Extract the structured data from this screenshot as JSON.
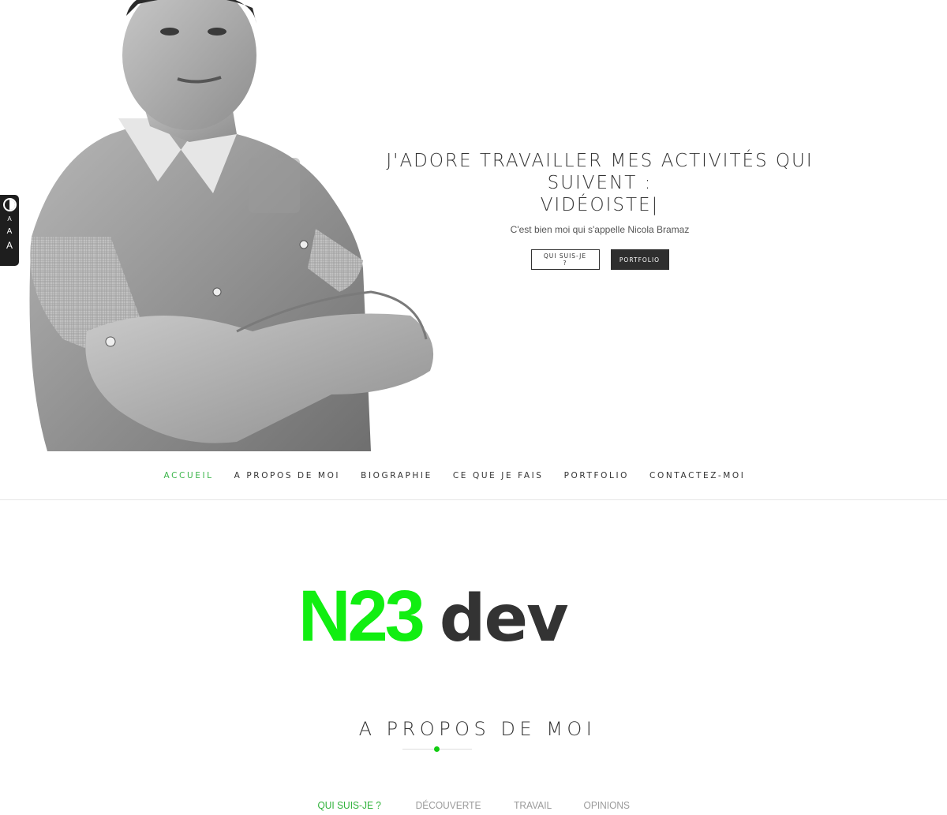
{
  "hero": {
    "title_line1": "J'ADORE TRAVAILLER MES ACTIVITÉS QUI SUIVENT :",
    "title_line2": "VIDÉOISTE",
    "title_cursor": "|",
    "subtitle": "C'est bien moi qui s'appelle Nicola Bramaz",
    "buttons": {
      "about": "QUI SUIS-JE ?",
      "portfolio": "PORTFOLIO"
    }
  },
  "accessibility": {
    "icon": "contrast-icon",
    "font_small": "A",
    "font_medium": "A",
    "font_large": "A"
  },
  "nav": {
    "items": [
      {
        "label": "ACCUEIL",
        "active": true
      },
      {
        "label": "A PROPOS DE MOI",
        "active": false
      },
      {
        "label": "BIOGRAPHIE",
        "active": false
      },
      {
        "label": "CE QUE JE FAIS",
        "active": false
      },
      {
        "label": "PORTFOLIO",
        "active": false
      },
      {
        "label": "CONTACTEZ-MOI",
        "active": false
      }
    ]
  },
  "logo": {
    "part1": "N23",
    "part2": "dev"
  },
  "section": {
    "title": "A PROPOS DE MOI",
    "tabs": [
      {
        "label": "QUI SUIS-JE ?",
        "active": true
      },
      {
        "label": "DÉCOUVERTE",
        "active": false
      },
      {
        "label": "TRAVAIL",
        "active": false
      },
      {
        "label": "OPINIONS",
        "active": false
      }
    ]
  },
  "colors": {
    "accent": "#3bb54a",
    "logo_green": "#11ee11",
    "dark": "#2e2e2e"
  }
}
